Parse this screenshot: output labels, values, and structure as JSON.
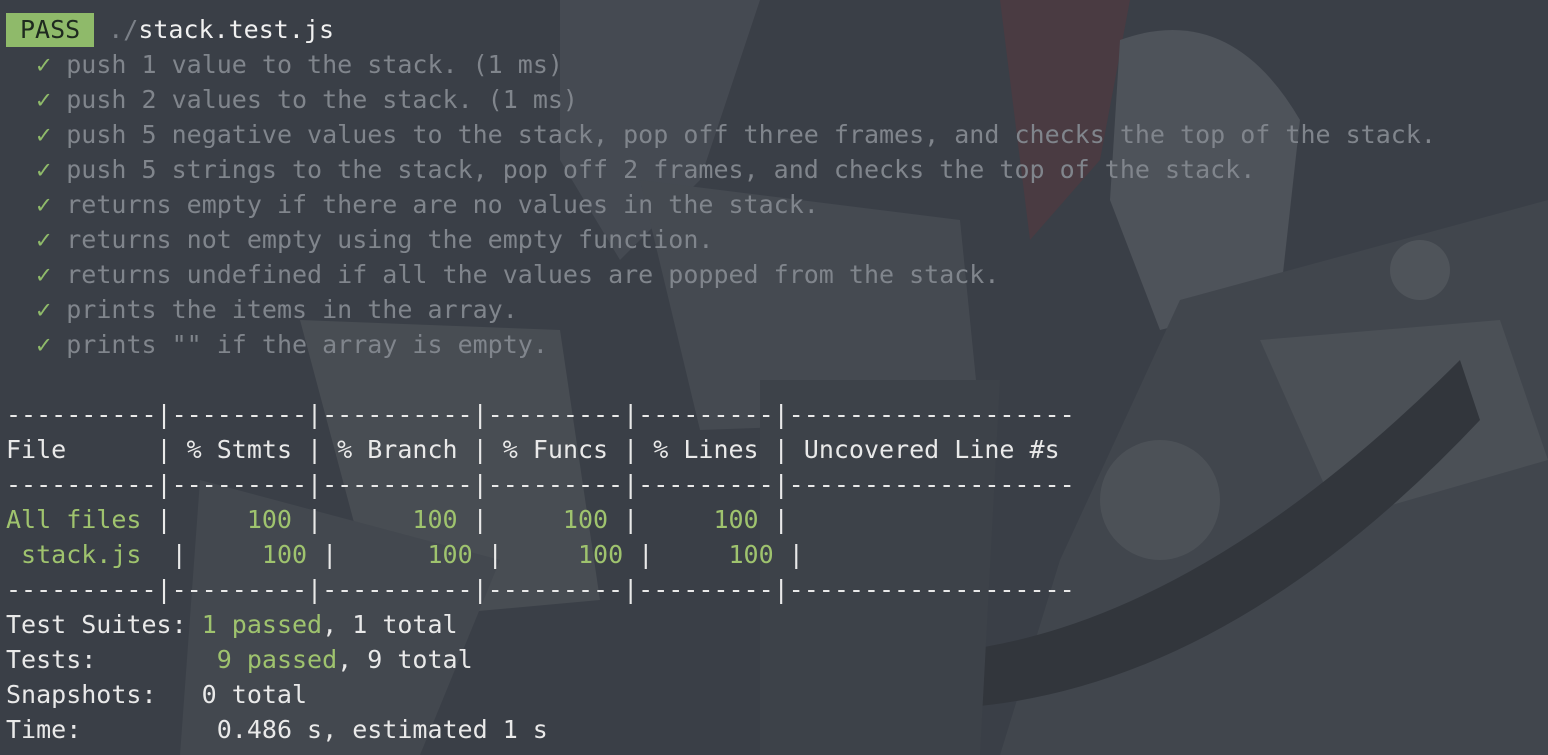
{
  "header": {
    "status_badge": "PASS",
    "path_prefix": "./",
    "file": "stack.test.js"
  },
  "check_symbol": "✓",
  "tests": [
    {
      "name": "push 1 value to the stack. (1 ms)"
    },
    {
      "name": "push 2 values to the stack. (1 ms)"
    },
    {
      "name": "push 5 negative values to the stack, pop off three frames, and checks the top of the stack."
    },
    {
      "name": "push 5 strings to the stack, pop off 2 frames, and checks the top of the stack."
    },
    {
      "name": "returns empty if there are no values in the stack."
    },
    {
      "name": "returns not empty using the empty function."
    },
    {
      "name": "returns undefined if all the values are popped from the stack."
    },
    {
      "name": "prints the items in the array."
    },
    {
      "name": "prints \"\" if the array is empty."
    }
  ],
  "coverage": {
    "separator": "----------|---------|----------|---------|---------|-------------------",
    "headers": [
      "File",
      "% Stmts",
      "% Branch",
      "% Funcs",
      "% Lines",
      "Uncovered Line #s"
    ],
    "rows": [
      [
        "All files",
        "100",
        "100",
        "100",
        "100",
        ""
      ],
      [
        " stack.js",
        "100",
        "100",
        "100",
        "100",
        ""
      ]
    ]
  },
  "summary": {
    "suites_label": "Test Suites:",
    "suites_passed": "1 passed",
    "suites_total": ", 1 total",
    "tests_label": "Tests:",
    "tests_passed": "9 passed",
    "tests_total": ", 9 total",
    "snapshots_label": "Snapshots:",
    "snapshots_value": "0 total",
    "time_label": "Time:",
    "time_value": "0.486 s, estimated 1 s"
  },
  "colors": {
    "background": "#3b4048",
    "pass_badge": "#8fba6a",
    "success_text": "#9fc36e",
    "dim_text": "#80858c"
  }
}
